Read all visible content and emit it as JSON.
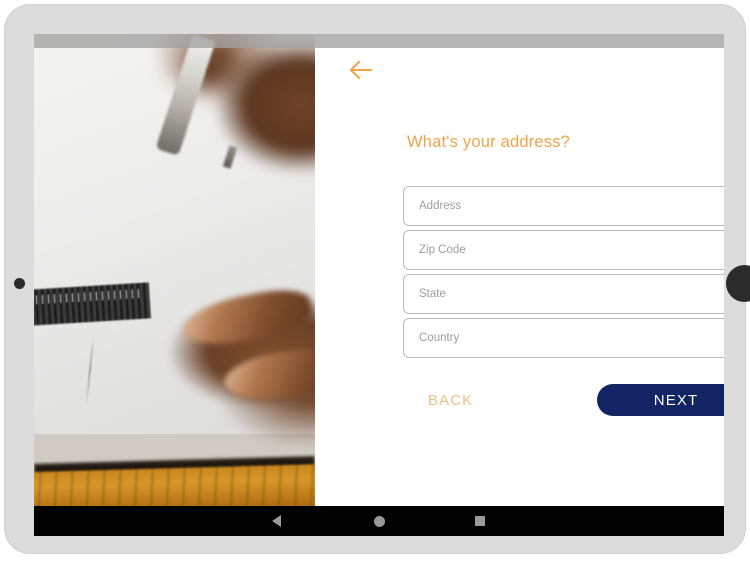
{
  "device": {
    "frame_color": "#dcdcdc",
    "camera_icon": "camera-dot",
    "side_button_icon": "side-button"
  },
  "screen": {
    "status_bar": {
      "color": "#a0a0a0"
    }
  },
  "photo": {
    "alt": "close-up of hands writing with a pen on a notebook on a wooden table",
    "table_color": "#c9871d",
    "paper_color": "#f0efed"
  },
  "form": {
    "back_arrow_icon": "arrow-left-icon",
    "title": "What's your address?",
    "accent_color": "#F0A44A",
    "fields": [
      {
        "name": "address",
        "placeholder": "Address",
        "value": ""
      },
      {
        "name": "zip-code",
        "placeholder": "Zip Code",
        "value": ""
      },
      {
        "name": "state",
        "placeholder": "State",
        "value": ""
      },
      {
        "name": "country",
        "placeholder": "Country",
        "value": ""
      }
    ],
    "buttons": {
      "back_label": "BACK",
      "back_color": "#EFC089",
      "next_label": "NEXT",
      "next_bg": "#122461",
      "next_text_color": "#FFFFFF"
    }
  },
  "nav_bar": {
    "background": "#000000",
    "icon_color": "#9a9a9a",
    "items": [
      {
        "name": "back",
        "icon": "triangle-back-icon"
      },
      {
        "name": "home",
        "icon": "circle-home-icon"
      },
      {
        "name": "recents",
        "icon": "square-recents-icon"
      }
    ]
  }
}
